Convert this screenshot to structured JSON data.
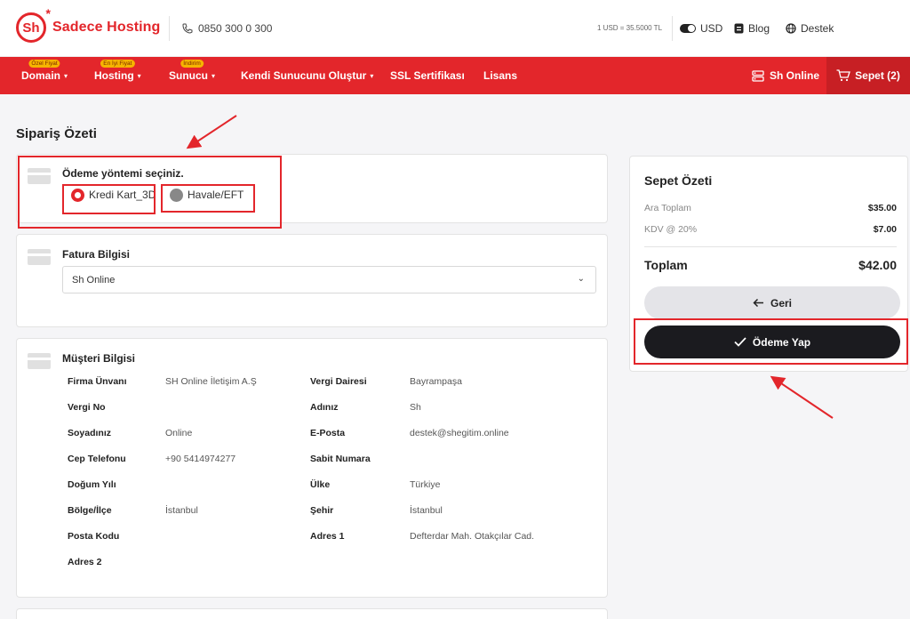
{
  "brand": {
    "logo_mark": "Sh",
    "logo_star": "*",
    "name": "Sadece Hosting"
  },
  "topbar": {
    "phone": "0850 300 0 300",
    "rate": "1 USD = 35.5000 TL",
    "currency": "USD",
    "blog": "Blog",
    "support": "Destek"
  },
  "nav": {
    "items": [
      {
        "label": "Domain",
        "badge": "Özel Fiyat",
        "caret": "▾"
      },
      {
        "label": "Hosting",
        "badge": "En İyi Fiyat",
        "caret": "▾"
      },
      {
        "label": "Sunucu",
        "badge": "İndirim",
        "caret": "▾"
      },
      {
        "label": "Kendi Sunucunu Oluştur",
        "caret": "▾"
      },
      {
        "label": "SSL Sertifikası"
      },
      {
        "label": "Lisans"
      }
    ],
    "account": "Sh Online",
    "cart": "Sepet (2)"
  },
  "page": {
    "title": "Sipariş Özeti"
  },
  "payment": {
    "title": "Ödeme yöntemi seçiniz.",
    "options": [
      {
        "label": "Kredi Kart_3D",
        "selected": true
      },
      {
        "label": "Havale/EFT",
        "selected": false
      }
    ]
  },
  "invoice": {
    "title": "Fatura Bilgisi",
    "selected": "Sh Online"
  },
  "customer": {
    "title": "Müşteri Bilgisi",
    "left": [
      {
        "label": "Firma Ünvanı",
        "value": "SH Online İletişim A.Ş"
      },
      {
        "label": "Vergi No",
        "value": ""
      },
      {
        "label": "Soyadınız",
        "value": "Online"
      },
      {
        "label": "Cep Telefonu",
        "value": "+90 5414974277"
      },
      {
        "label": "Doğum Yılı",
        "value": ""
      },
      {
        "label": "Bölge/İlçe",
        "value": "İstanbul"
      },
      {
        "label": "Posta Kodu",
        "value": ""
      },
      {
        "label": "Adres 2",
        "value": ""
      }
    ],
    "right": [
      {
        "label": "Vergi Dairesi",
        "value": "Bayrampaşa"
      },
      {
        "label": "Adınız",
        "value": "Sh"
      },
      {
        "label": "E-Posta",
        "value": "destek@shegitim.online"
      },
      {
        "label": "Sabit Numara",
        "value": ""
      },
      {
        "label": "Ülke",
        "value": "Türkiye"
      },
      {
        "label": "Şehir",
        "value": "İstanbul"
      },
      {
        "label": "Adres 1",
        "value": "Defterdar Mah. Otakçılar Cad."
      }
    ]
  },
  "summary": {
    "title": "Sepet Özeti",
    "subtotal_label": "Ara Toplam",
    "subtotal": "$35.00",
    "vat_label": "KDV @ 20%",
    "vat": "$7.00",
    "total_label": "Toplam",
    "total": "$42.00",
    "back_button": "Geri",
    "pay_button": "Ödeme Yap"
  },
  "colors": {
    "brand_red": "#e3262b",
    "dark_button": "#1b1b1f",
    "badge_yellow": "#f6b400"
  }
}
